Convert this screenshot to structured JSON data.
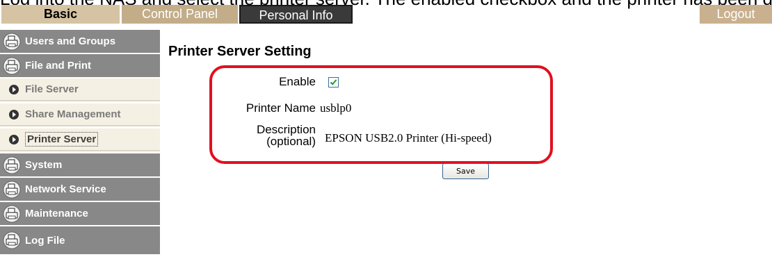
{
  "caption_fragment": "Log into the NAS and select the printer server. The enabled checkbox and the printer has been detected.",
  "tabs": {
    "basic": "Basic",
    "control_panel": "Control Panel",
    "personal_info": "Personal Info",
    "logout": "Logout"
  },
  "sidebar": {
    "items": [
      {
        "label": "Users and Groups",
        "type": "group"
      },
      {
        "label": "File and Print",
        "type": "group"
      },
      {
        "label": "File Server",
        "type": "sub"
      },
      {
        "label": "Share Management",
        "type": "sub"
      },
      {
        "label": "Printer Server",
        "type": "sub",
        "active": true
      },
      {
        "label": "System",
        "type": "group"
      },
      {
        "label": "Network Service",
        "type": "group"
      },
      {
        "label": "Maintenance",
        "type": "group"
      },
      {
        "label": "Log File",
        "type": "group"
      }
    ]
  },
  "main": {
    "title": "Printer Server Setting",
    "enable_label": "Enable",
    "enable_checked": true,
    "printer_name_label": "Printer Name",
    "printer_name_value": "usblp0",
    "description_label_1": "Description",
    "description_label_2": "(optional)",
    "description_value": "EPSON USB2.0 Printer (Hi-speed)",
    "save_label": "Save"
  },
  "colors": {
    "highlight_border": "#e01020",
    "sidebar_group": "#888888",
    "sidebar_sub": "#f5f0e4",
    "tab_basic": "#d5c3a3"
  }
}
